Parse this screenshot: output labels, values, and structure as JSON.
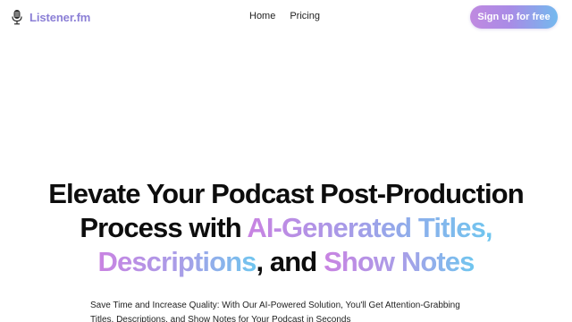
{
  "nav": {
    "brand": "Listener.fm",
    "logo_icon": "microphone-icon",
    "links": [
      {
        "label": "Home"
      },
      {
        "label": "Pricing"
      }
    ],
    "cta_label": "Sign up for free"
  },
  "hero": {
    "line1": "Elevate Your Podcast Post-Production",
    "line2_plain": "Process with ",
    "line2_grad": "AI-Generated Titles,",
    "line3_grad_a": "Descriptions",
    "line3_plain_a": ", and ",
    "line3_grad_b": "Show Notes",
    "subtitle": "Save Time and Increase Quality: With Our AI-Powered Solution, You'll Get Attention-Grabbing Titles, Descriptions, and Show Notes for Your Podcast in Seconds"
  },
  "colors": {
    "gradient_start": "#c983e2",
    "gradient_end": "#6fc6ef",
    "brand_text": "#8b7fd6"
  }
}
